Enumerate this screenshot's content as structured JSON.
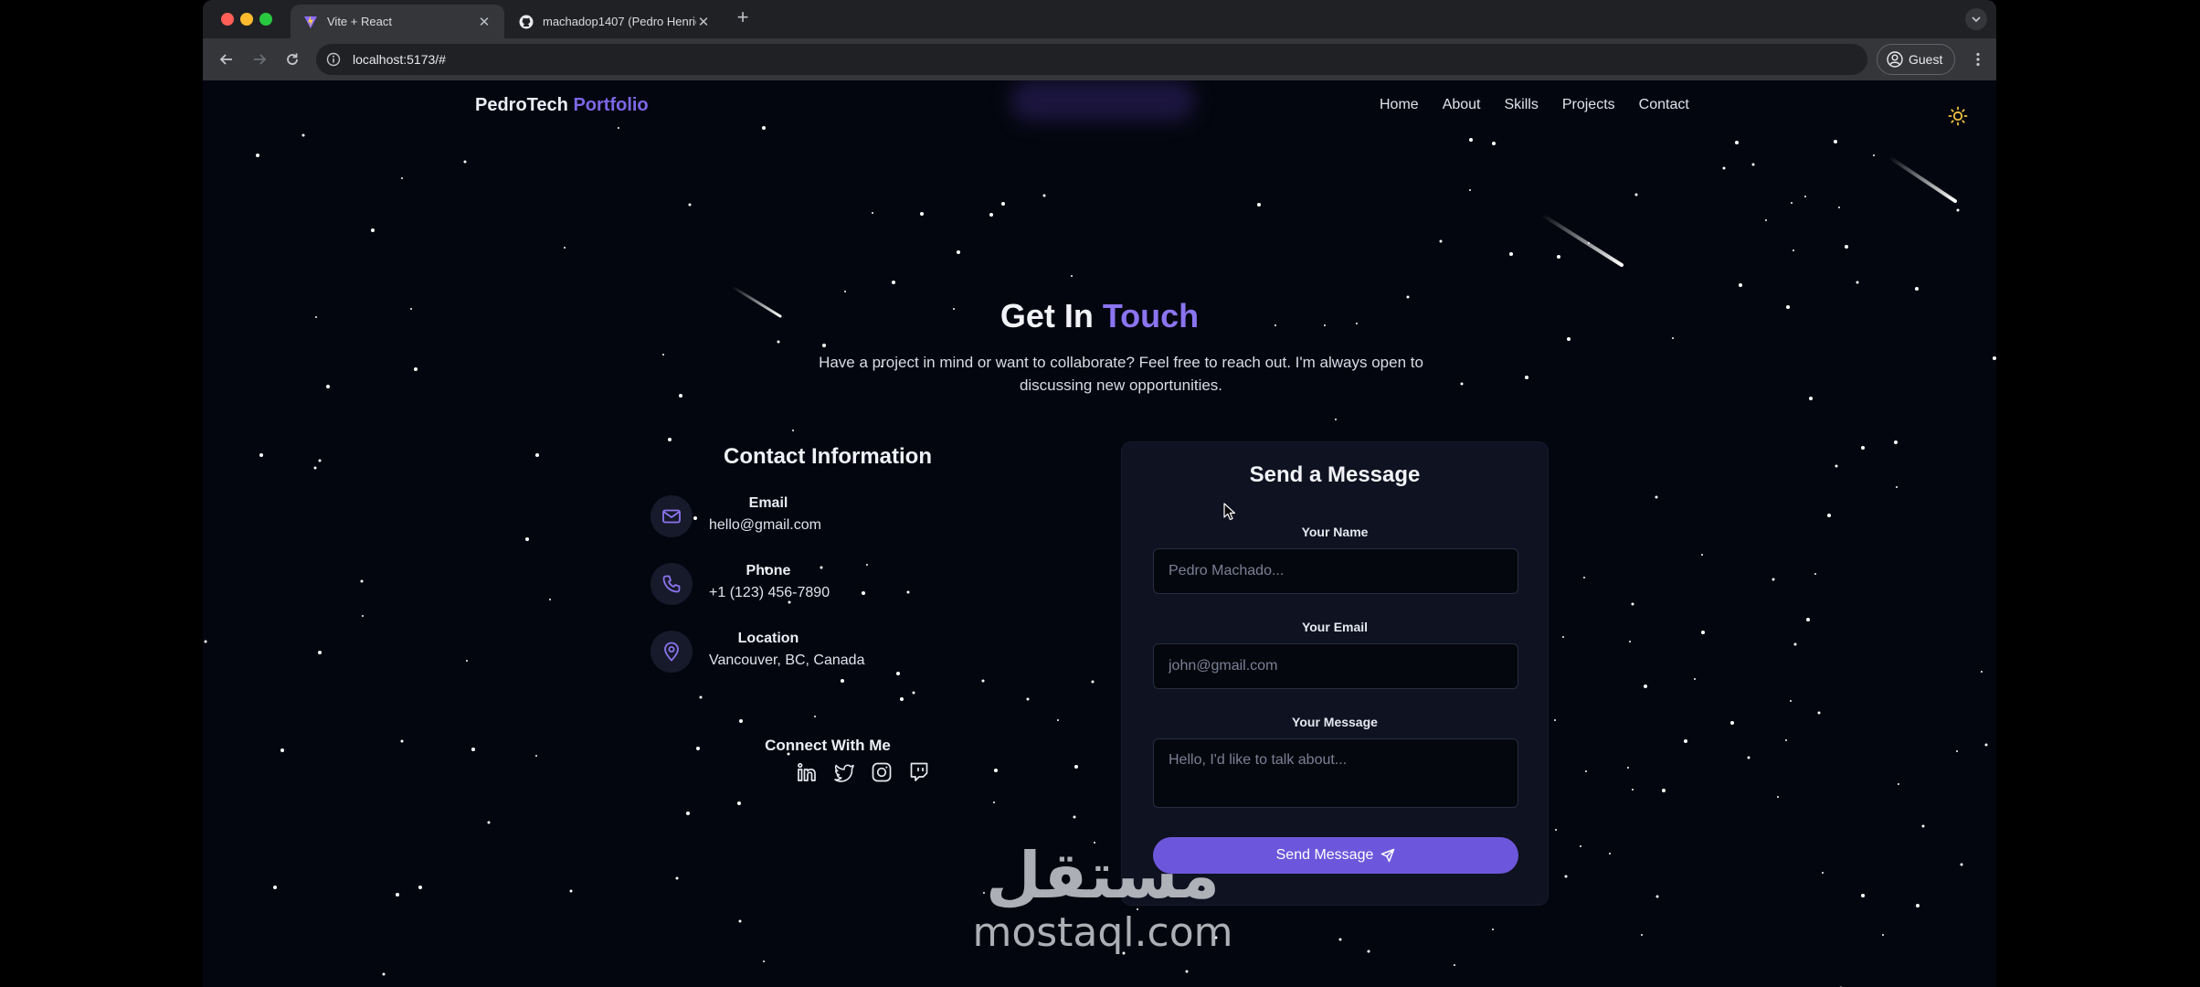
{
  "browser": {
    "tabs": [
      {
        "title": "Vite + React",
        "icon": "vite-icon",
        "active": true
      },
      {
        "title": "machadop1407 (Pedro Henrique)",
        "icon": "github-icon",
        "active": false
      }
    ],
    "new_tab": "+",
    "url": "localhost:5173/#",
    "profile_label": "Guest"
  },
  "nav": {
    "brand": "PedroTech",
    "brand_accent": "Portfolio",
    "links": [
      "Home",
      "About",
      "Skills",
      "Projects",
      "Contact"
    ]
  },
  "hero": {
    "title": "Get In",
    "title_accent": "Touch",
    "subtitle": "Have a project in mind or want to collaborate? Feel free to reach out. I'm always open to discussing new opportunities."
  },
  "contact_info": {
    "title": "Contact Information",
    "items": [
      {
        "label": "Email",
        "value": "hello@gmail.com",
        "icon": "mail-icon"
      },
      {
        "label": "Phone",
        "value": "+1 (123) 456-7890",
        "icon": "phone-icon"
      },
      {
        "label": "Location",
        "value": "Vancouver, BC, Canada",
        "icon": "map-pin-icon"
      }
    ],
    "connect_title": "Connect With Me",
    "socials": [
      "linkedin-icon",
      "twitter-icon",
      "instagram-icon",
      "twitch-icon"
    ]
  },
  "form": {
    "title": "Send a Message",
    "name_label": "Your Name",
    "name_placeholder": "Pedro Machado...",
    "email_label": "Your Email",
    "email_placeholder": "john@gmail.com",
    "message_label": "Your Message",
    "message_placeholder": "Hello, I'd like to talk about...",
    "submit_label": "Send Message"
  },
  "watermark": {
    "arabic": "مستقل",
    "latin": "mostaql.com"
  },
  "colors": {
    "accent": "#7c67e6",
    "background": "#04060f",
    "card": "#0f1220",
    "button": "#6c57dc",
    "sun": "#f5c542"
  }
}
